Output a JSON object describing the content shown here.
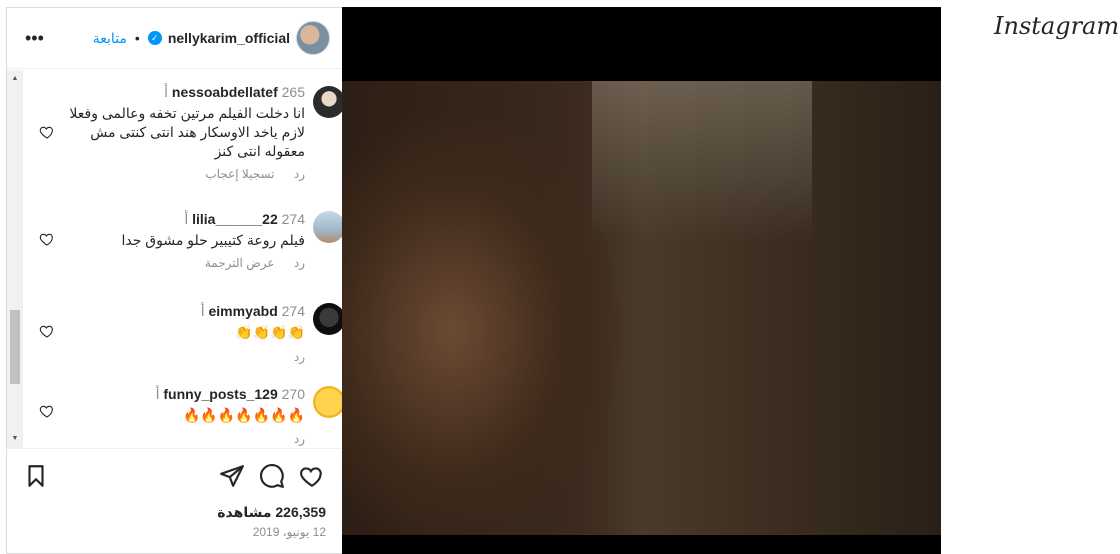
{
  "header": {
    "username": "nellykarim_official",
    "follow_label": "متابعة",
    "dot": "•",
    "more_glyph": "•••",
    "verified_glyph": "✓"
  },
  "comments": [
    {
      "user": "nessoabdellatef",
      "time": "265 أ",
      "text": "انا دخلت الفيلم مرتين تخفه وعالمى وفعلا لازم ياخد الاوسكار هند انتى كنتى مش معقوله انتى كنز",
      "actions": [
        "رد",
        "تسجيلا إعجاب"
      ]
    },
    {
      "user": "lilia______22",
      "time": "274 أ",
      "text": "فيلم روعة كتيبير حلو مشوق جدا",
      "actions": [
        "رد",
        "عرض الترجمة"
      ]
    },
    {
      "user": "eimmyabd",
      "time": "274 أ",
      "text": "👏👏👏👏",
      "actions": [
        "رد"
      ]
    },
    {
      "user": "funny_posts_129",
      "time": "270 أ",
      "text": "🔥🔥🔥🔥🔥🔥🔥",
      "actions": [
        "رد"
      ]
    }
  ],
  "stats": {
    "views": "226,359 مشاهدة",
    "date": "12 يونيو، 2019"
  },
  "scroll": {
    "up": "▲",
    "down": "▼"
  },
  "brand": {
    "logo": "Instagram"
  },
  "icons": {
    "more": "more-icon",
    "verified": "verified-badge-icon",
    "heart": "heart-icon",
    "comment": "comment-icon",
    "share": "paper-plane-icon",
    "save": "bookmark-icon"
  }
}
